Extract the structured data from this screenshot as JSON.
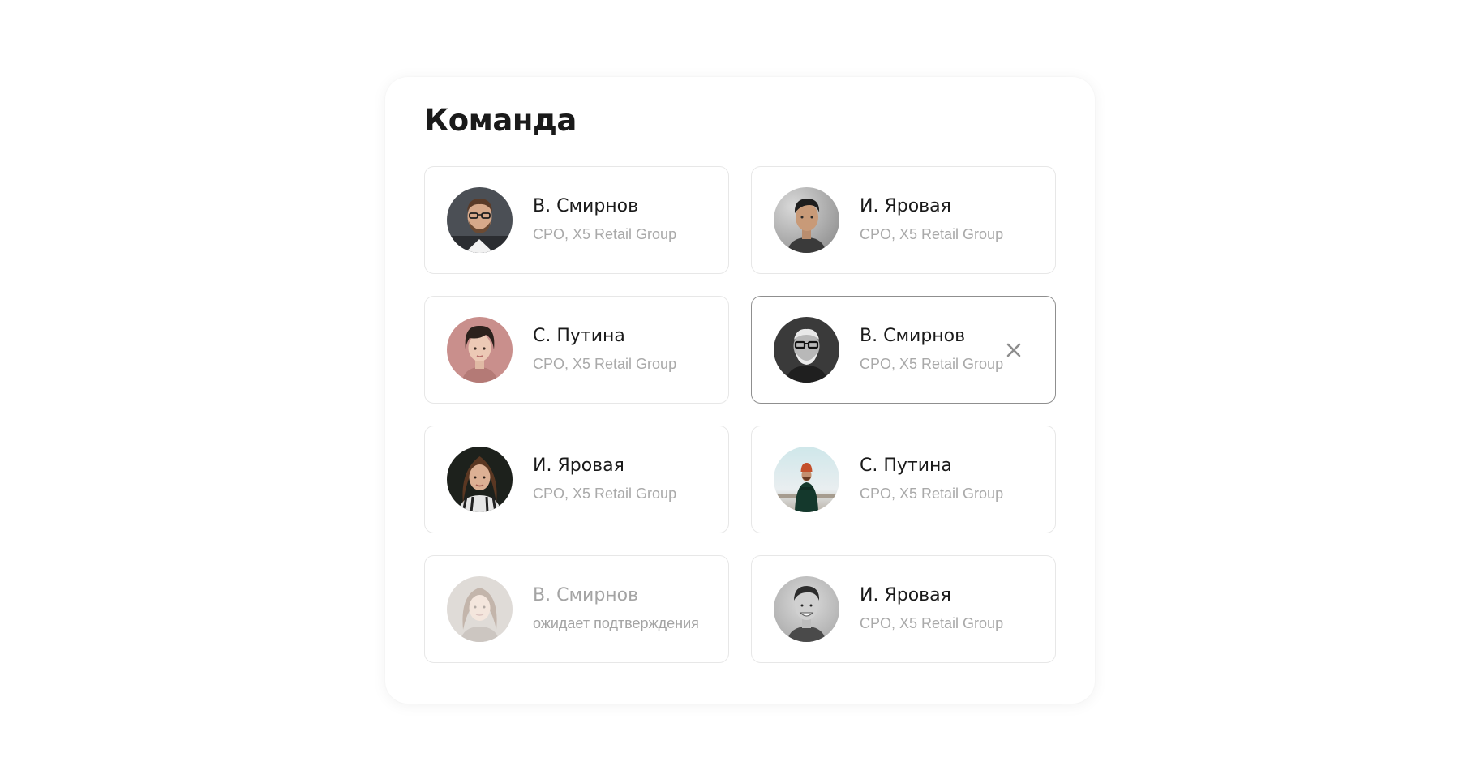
{
  "panel": {
    "title": "Команда"
  },
  "members": [
    {
      "name": "В. Смирнов",
      "role": "CPO, X5 Retail Group",
      "avatar": "avatar-man-glasses-beard",
      "status": "active"
    },
    {
      "name": "И. Яровая",
      "role": "CPO, X5 Retail Group",
      "avatar": "avatar-young-man",
      "status": "active"
    },
    {
      "name": "С. Путина",
      "role": "CPO, X5 Retail Group",
      "avatar": "avatar-woman-dark-hair",
      "status": "active"
    },
    {
      "name": "В. Смирнов",
      "role": "CPO, X5 Retail Group",
      "avatar": "avatar-older-man-glasses",
      "status": "selected"
    },
    {
      "name": "И. Яровая",
      "role": "CPO, X5 Retail Group",
      "avatar": "avatar-woman-long-hair",
      "status": "active"
    },
    {
      "name": "С. Путина",
      "role": "CPO, X5 Retail Group",
      "avatar": "avatar-man-red-beanie",
      "status": "active"
    },
    {
      "name": "В. Смирнов",
      "role": "ожидает подтверждения",
      "avatar": "avatar-woman-light-hair",
      "status": "pending"
    },
    {
      "name": "И. Яровая",
      "role": "CPO, X5 Retail Group",
      "avatar": "avatar-man-smiling",
      "status": "active"
    }
  ],
  "icons": {
    "remove": "close-icon"
  },
  "colors": {
    "card_border": "#e7e7e7",
    "selected_border": "#8f8f8f",
    "secondary_text": "#a9a9a9",
    "title_text": "#1a1a1a"
  }
}
